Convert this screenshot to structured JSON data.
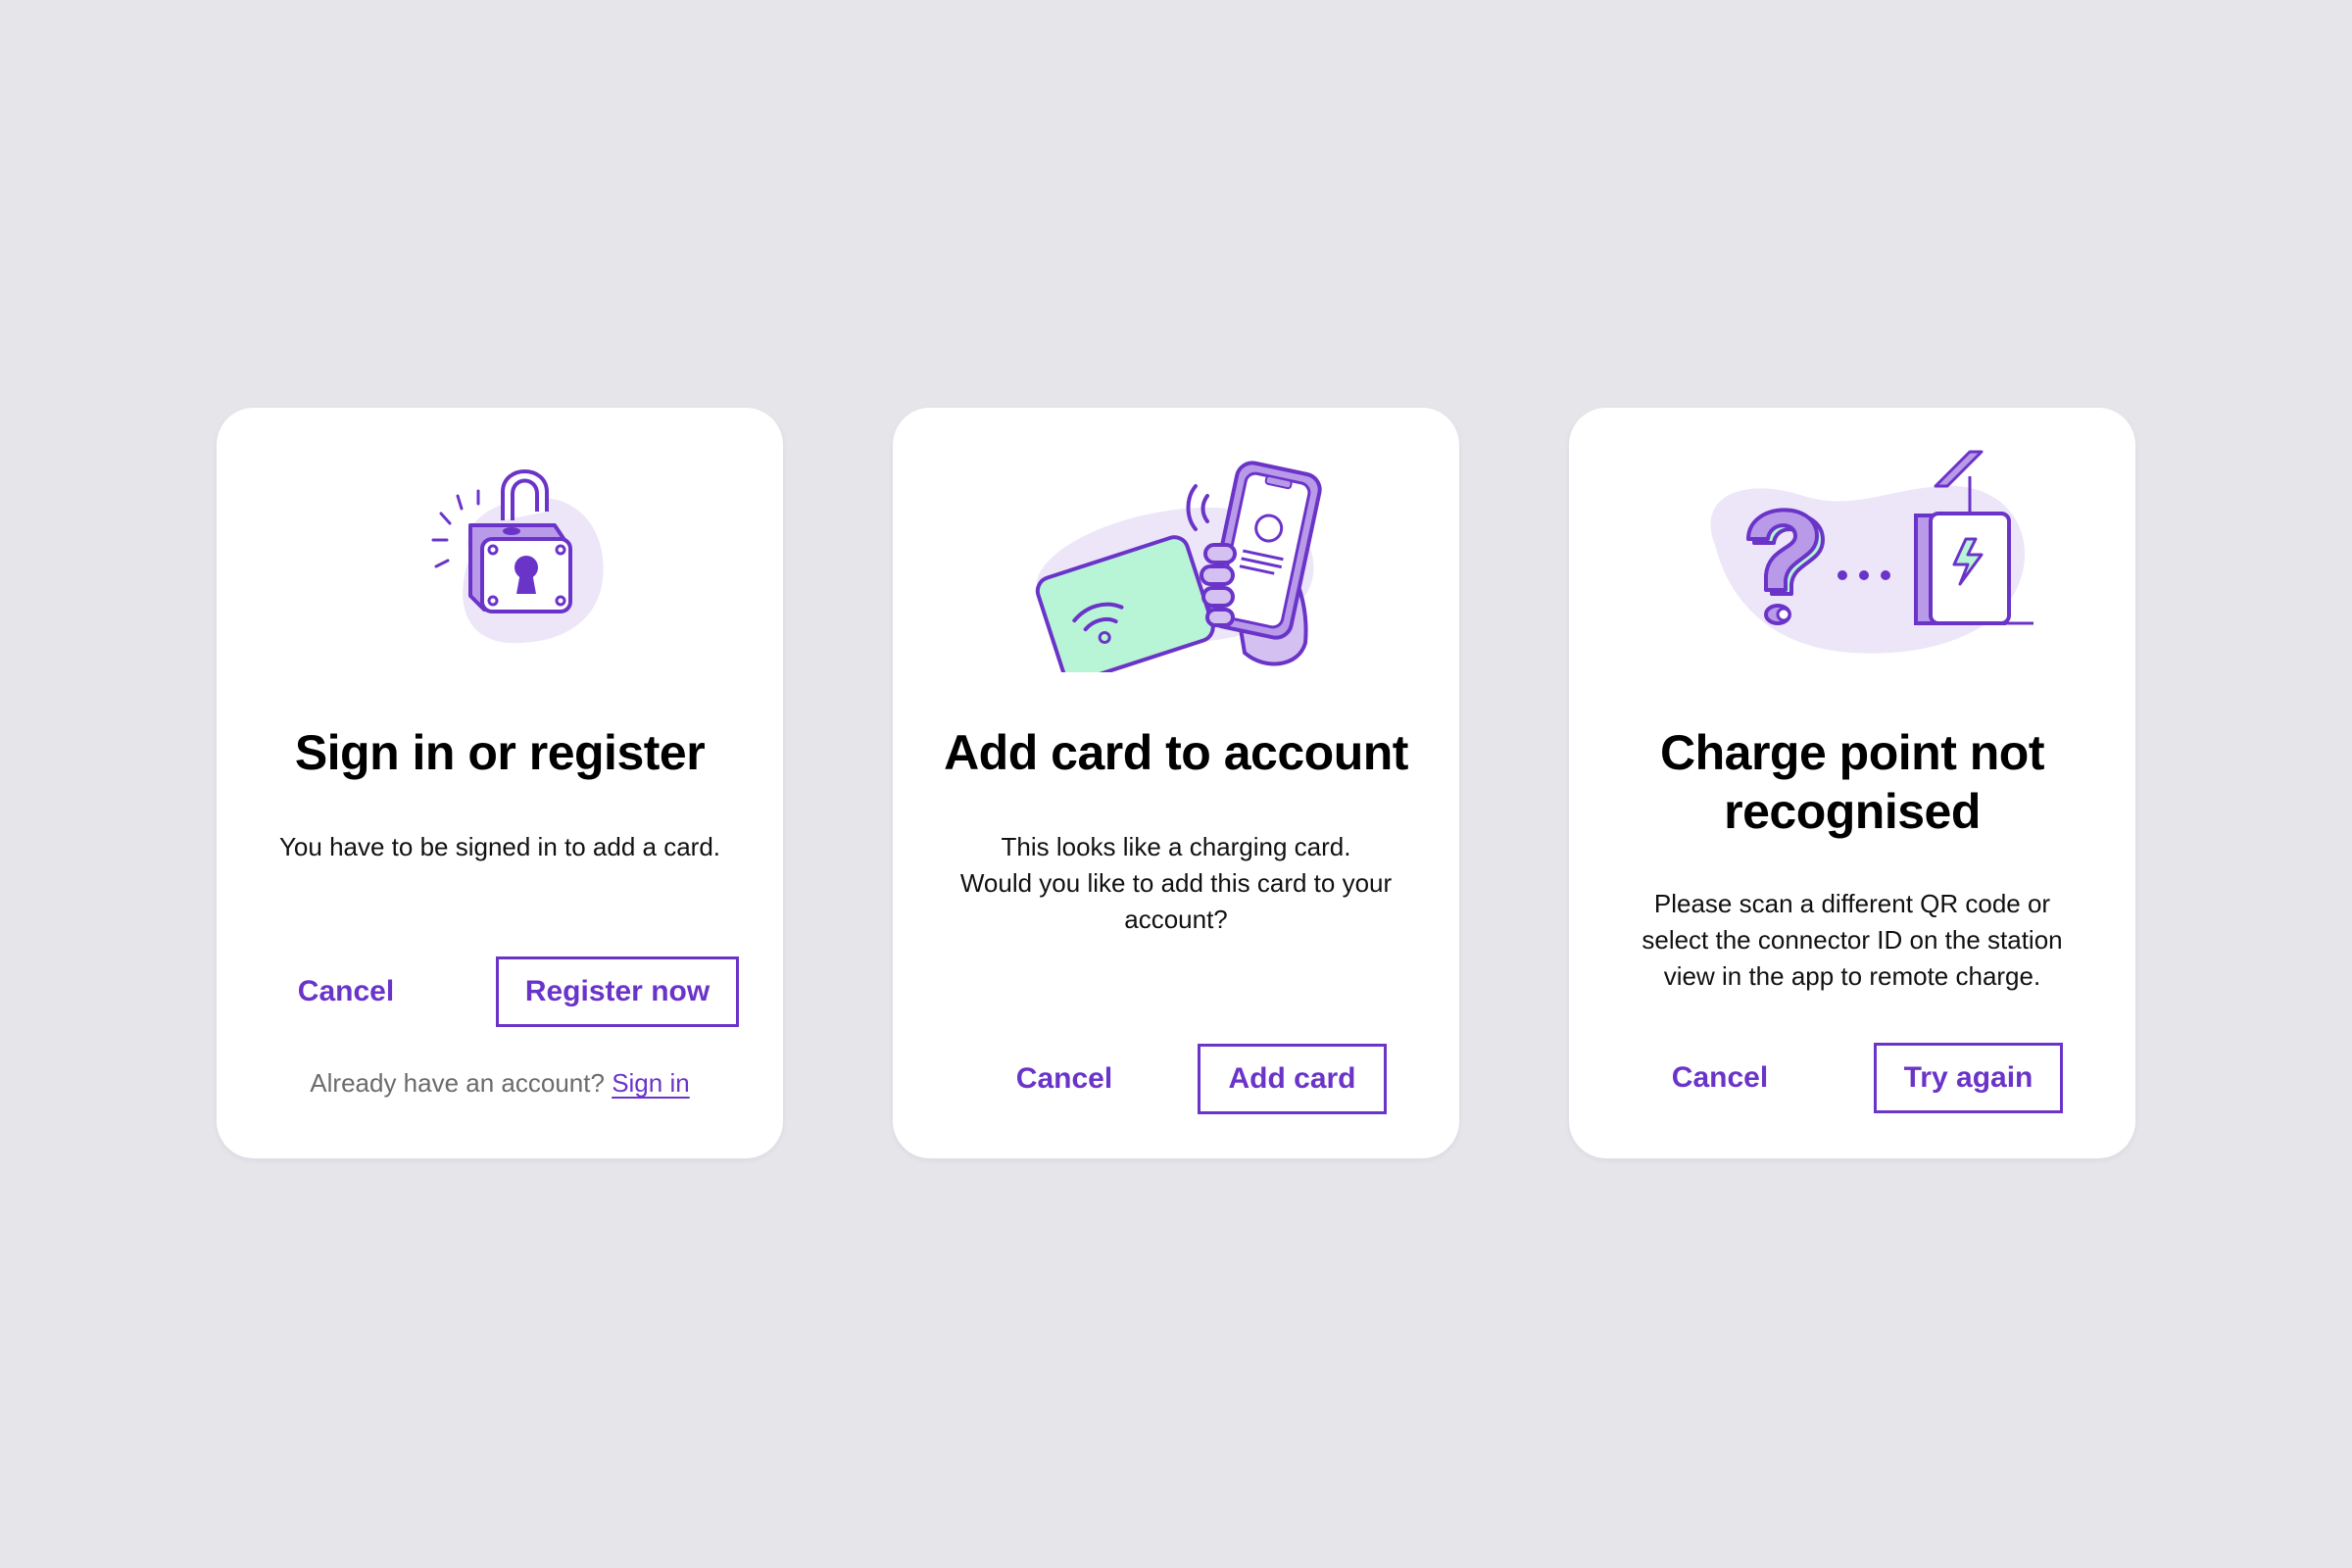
{
  "colors": {
    "background": "#e6e5ea",
    "card": "#ffffff",
    "accent": "#6b34c9",
    "illustration_blob": "#ece6f8",
    "illustration_mint": "#b8f5d6",
    "illustration_lavender": "#b99ae8"
  },
  "cards": [
    {
      "illustration": "padlock-icon",
      "title": "Sign in or register",
      "body": "You have to be signed in to add a card.",
      "cancel_label": "Cancel",
      "primary_label": "Register now",
      "footer_text": "Already have an account?",
      "footer_link": "Sign in"
    },
    {
      "illustration": "phone-card-tap-icon",
      "title": "Add card to account",
      "body_lines": [
        "This looks like a charging card.",
        "Would you like to add this card to your",
        "account?"
      ],
      "cancel_label": "Cancel",
      "primary_label": "Add card"
    },
    {
      "illustration": "charge-point-question-icon",
      "title_lines": [
        "Charge point not",
        "recognised"
      ],
      "body_lines": [
        "Please scan a different QR code or",
        "select the connector ID on the station",
        "view in the app to remote charge."
      ],
      "cancel_label": "Cancel",
      "primary_label": "Try again"
    }
  ]
}
